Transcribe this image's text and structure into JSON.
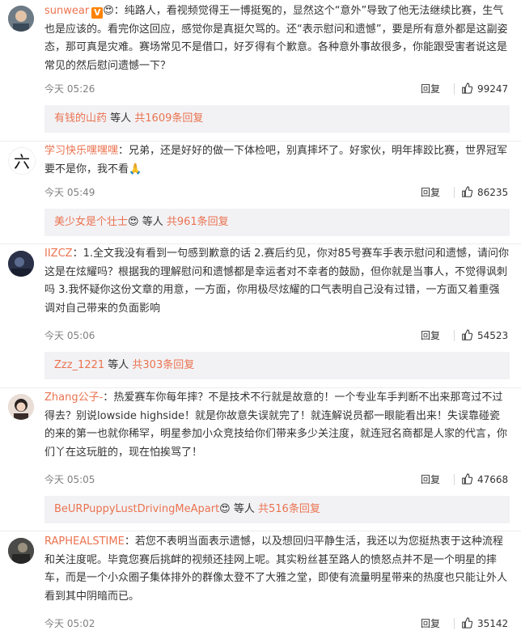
{
  "comments": [
    {
      "username": "sunwear",
      "prefix": "：",
      "text": "纯路人，看视频觉得王一博挺冤的，显然这个“意外”导致了他无法继续比赛，生气也是应该的。看完你这回应，感觉你是真挺欠骂的。还“表示慰问和遗憾”，要是所有意外都是这副姿态，那可真是灾难。赛场常见不是借口，好歹得有个歉意。各种意外事故很多，你能跟受害者说这是常见的然后慰问遗憾一下？",
      "time": "今天 05:26",
      "reply_label": "回复",
      "likes": "99247",
      "reply_preview": {
        "user": "有钱的山药",
        "middle": " 等人 ",
        "count_text": "共1609条回复"
      }
    },
    {
      "username": "学习快乐嘿嘿嘿",
      "prefix": "：",
      "text": "兄弟，还是好好的做一下体检吧，别真摔坏了。好家伙，明年摔跤比赛，世界冠军要不是你，我不看🙏",
      "time": "今天 05:49",
      "reply_label": "回复",
      "likes": "86235",
      "reply_preview": {
        "user": "美少女是个壮士",
        "middle": " 等人 ",
        "count_text": "共961条回复"
      }
    },
    {
      "username": "IIZCZ",
      "prefix": "：",
      "text": "1.全文我没有看到一句感到歉意的话 2.赛后约见，你对85号赛车手表示慰问和遗憾，请问你这是在炫耀吗？根据我的理解慰问和遗憾都是幸运者对不幸者的鼓励，但你就是当事人，不觉得讽刺吗 3.我怀疑你这份文章的用意，一方面，你用极尽炫耀的口气表明自己没有过错，一方面又着重强调对自己带来的负面影响",
      "time": "今天 05:06",
      "reply_label": "回复",
      "likes": "54523",
      "reply_preview": {
        "user": "Zzz_1221",
        "middle": " 等人 ",
        "count_text": "共303条回复"
      }
    },
    {
      "username": "Zhang公子-",
      "prefix": "：",
      "text": "热爱赛车你每年摔？不是技术不行就是故意的！一个专业车手判断不出来那弯过不过得去？别说lowside highside！就是你故意失误就完了！就连解说员都一眼能看出来！失误靠碰瓷的来的第一也就你稀罕，明星参加小众竞技给你们带来多少关注度，就连冠名商都是人家的代言，你们丫在这玩脏的，现在怕挨骂了！",
      "time": "今天 05:05",
      "reply_label": "回复",
      "likes": "47668",
      "reply_preview": {
        "user": "BeURPuppyLustDrivingMeApart",
        "middle": " 等人 ",
        "count_text": "共516条回复"
      }
    },
    {
      "username": "RAPHEALSTIME",
      "prefix": "：",
      "text": "若您不表明当面表示遗憾，以及想回归平静生活，我还以为您挺热衷于这种流程和关注度呢。毕竟您赛后挑衅的视频还挂网上呢。其实粉丝甚至路人的愤怒点并不是一个明星的摔车，而是一个小众圈子集体排外的群像太登不了大雅之堂，即使有流量明星带来的热度也只能让外人看到其中阴暗而已。",
      "time": "今天 05:02",
      "reply_label": "回复",
      "likes": "35142"
    }
  ],
  "colors": {
    "username": "#eb7350",
    "meta": "#808080",
    "reply_bg": "#f2f2f5",
    "vip": "#ff8200"
  },
  "icons": {
    "like": "thumbs-up-icon",
    "vip": "v-verified-icon",
    "emoji": "emoji-icon"
  }
}
